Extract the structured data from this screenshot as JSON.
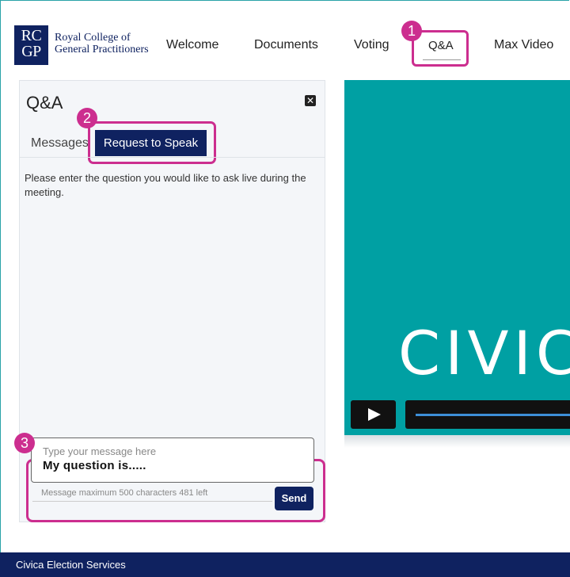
{
  "header": {
    "logo_line1": "RC",
    "logo_line2": "GP",
    "org_name": "Royal College of General Practitioners",
    "nav": [
      {
        "label": "Welcome"
      },
      {
        "label": "Documents"
      },
      {
        "label": "Voting"
      },
      {
        "label": "Q&A"
      },
      {
        "label": "Max Video"
      }
    ]
  },
  "callouts": [
    "1",
    "2",
    "3"
  ],
  "qa_panel": {
    "title": "Q&A",
    "tabs": [
      {
        "label": "Messages"
      },
      {
        "label": "Request to Speak"
      }
    ],
    "instructions": "Please enter the question you would like to ask live during the meeting.",
    "message_placeholder": "Type your message here",
    "message_value": "My question is.....",
    "char_count": "Message maximum 500 characters 481 left",
    "send_label": "Send"
  },
  "video": {
    "logo_text": "CIVIC"
  },
  "footer": {
    "text": "Civica Election Services"
  },
  "colors": {
    "brand_navy": "#0f2260",
    "highlight_pink": "#cc2e8f",
    "video_teal": "#00a0a3",
    "progress_blue": "#3d8fd8"
  }
}
